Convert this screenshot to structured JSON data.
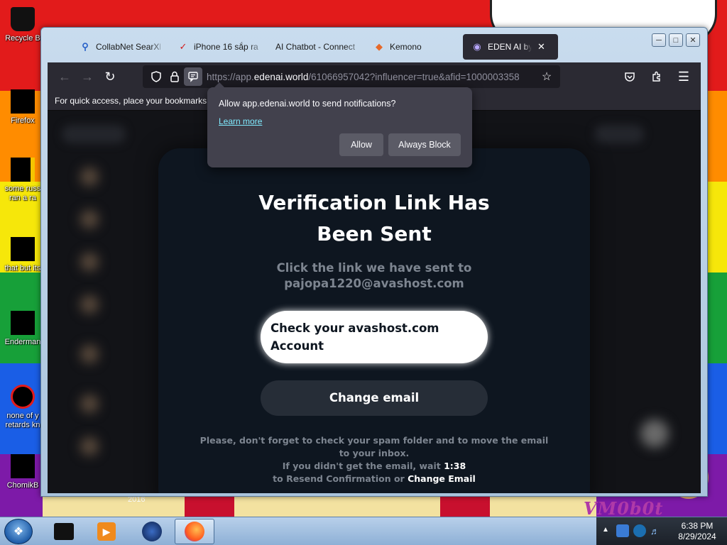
{
  "desktop": {
    "wallpaper_colors": [
      "#e21b1b",
      "#ff8c00",
      "#f6e70a",
      "#17a039",
      "#1a5ee6",
      "#7d1aa8"
    ],
    "icons": [
      {
        "label": "Recycle B"
      },
      {
        "label": "Firefox"
      },
      {
        "label": "some russ ran a ra"
      },
      {
        "label": "that but its"
      },
      {
        "label": "Enderman"
      },
      {
        "label": "none of y retards kn"
      },
      {
        "label": "ChomikB"
      }
    ],
    "wallpaper_year": "2016",
    "wallpaper_text": "VM0b0t"
  },
  "browser": {
    "tabs": [
      {
        "title": "CollabNet SearXN",
        "icon": "search-icon"
      },
      {
        "title": "iPhone 16 sắp ra",
        "icon": "news-icon"
      },
      {
        "title": "AI Chatbot - Connect",
        "icon": "none"
      },
      {
        "title": "Kemono",
        "icon": "fox-icon"
      },
      {
        "title": "EDEN AI by EVA",
        "icon": "eye-icon",
        "active": true
      }
    ],
    "url_prefix": "https://app.",
    "url_host": "edenai.world",
    "url_rest": "/61066957042?influencer=true&afid=1000003358",
    "bookmarks_hint": "For quick access, place your bookmarks h"
  },
  "notification": {
    "message": "Allow app.edenai.world to send notifications?",
    "learn_more": "Learn more",
    "allow": "Allow",
    "always_block": "Always Block"
  },
  "page": {
    "title": "Verification Link Has Been Sent",
    "subtitle": "Click the link we have sent to",
    "email": "pajopa1220@avashost.com",
    "check_button": "Check your avashost.com Account",
    "change_button": "Change email",
    "footer_line1": "Please, don't forget to check your spam folder and to move the email to your inbox.",
    "footer_wait": "If you didn't get the email, wait",
    "footer_timer": "1:38",
    "footer_resend": "to Resend Confirmation or",
    "footer_change_link": "Change Email"
  },
  "taskbar": {
    "time": "6:38 PM",
    "date": "8/29/2024"
  }
}
